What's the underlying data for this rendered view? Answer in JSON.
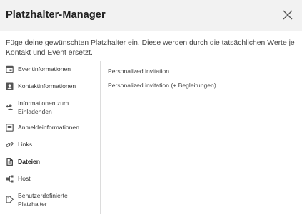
{
  "dialog": {
    "title": "Platzhalter-Manager",
    "description": "Füge deine gewünschten Platzhalter ein. Diese werden durch die tatsächlichen Werte je Kontakt und Event ersetzt."
  },
  "sidebar": {
    "items": [
      {
        "label": "Eventinformationen",
        "icon": "calendar-card-icon"
      },
      {
        "label": "Kontaktinformationen",
        "icon": "contact-card-icon"
      },
      {
        "label": "Informationen zum Einladenden",
        "icon": "person-add-icon"
      },
      {
        "label": "Anmeldeinformationen",
        "icon": "list-form-icon"
      },
      {
        "label": "Links",
        "icon": "link-icon"
      },
      {
        "label": "Dateien",
        "icon": "file-icon",
        "active": true
      },
      {
        "label": "Host",
        "icon": "hierarchy-icon"
      },
      {
        "label": "Benutzerdefinierte Platzhalter",
        "icon": "tag-icon"
      }
    ]
  },
  "placeholders": [
    "Personalized invitation",
    "Personalized invitation (+ Begleitungen)"
  ],
  "colors": {
    "header_bg": "#f2f2f2",
    "text": "#333333",
    "divider": "#dcdcdc"
  }
}
